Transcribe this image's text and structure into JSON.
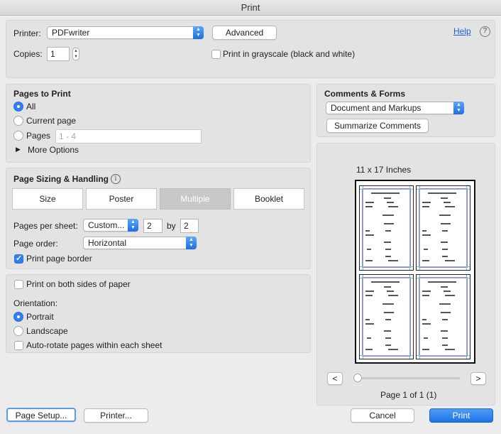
{
  "window": {
    "title": "Print"
  },
  "printer": {
    "label": "Printer:",
    "selected": "PDFwriter",
    "advanced_label": "Advanced",
    "help_label": "Help",
    "help_icon": "question-circle-icon"
  },
  "copies": {
    "label": "Copies:",
    "value": "1",
    "grayscale_label": "Print in grayscale (black and white)",
    "grayscale_checked": false
  },
  "pages_to_print": {
    "heading": "Pages to Print",
    "all_label": "All",
    "current_label": "Current page",
    "pages_label": "Pages",
    "pages_placeholder": "1 - 4",
    "selected": "all",
    "more_options_label": "More Options"
  },
  "sizing": {
    "heading": "Page Sizing & Handling",
    "tabs": [
      "Size",
      "Poster",
      "Multiple",
      "Booklet"
    ],
    "selected_tab": "Multiple",
    "pages_per_sheet_label": "Pages per sheet:",
    "pages_per_sheet_value": "Custom...",
    "cols": "2",
    "by_label": "by",
    "rows": "2",
    "page_order_label": "Page order:",
    "page_order_value": "Horizontal",
    "border_label": "Print page border",
    "border_checked": true
  },
  "orientation": {
    "both_sides_label": "Print on both sides of paper",
    "heading": "Orientation:",
    "portrait_label": "Portrait",
    "landscape_label": "Landscape",
    "selected": "portrait",
    "autorotate_label": "Auto-rotate pages within each sheet"
  },
  "comments": {
    "heading": "Comments & Forms",
    "selected": "Document and Markups",
    "summarize_label": "Summarize Comments"
  },
  "preview": {
    "paper_size": "11 x 17 Inches",
    "prev_label": "<",
    "next_label": ">",
    "page_info": "Page 1 of 1 (1)",
    "slider_position": 0
  },
  "footer": {
    "page_setup_label": "Page Setup...",
    "printer_label": "Printer...",
    "cancel_label": "Cancel",
    "print_label": "Print"
  },
  "colors": {
    "accent": "#2f7ff0",
    "print_button": "#1d72e8",
    "link": "#1a63d8"
  }
}
